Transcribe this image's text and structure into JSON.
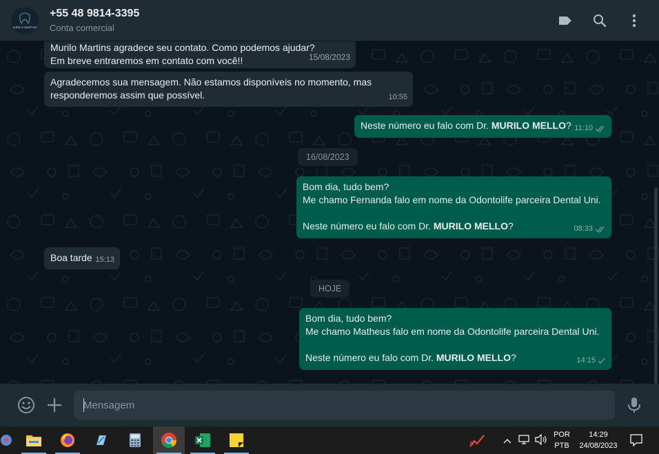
{
  "header": {
    "avatar_text": "MURILO MARTINS",
    "contact_name": "+55 48 9814-3395",
    "subtitle": "Conta comercial",
    "icons": [
      "label-icon",
      "search-icon",
      "menu-dots-icon"
    ]
  },
  "messages": [
    {
      "dir": "in",
      "lines": [
        "Murilo Martins agradece seu contato. Como podemos ajudar?",
        "Em breve entraremos em contato com você!!"
      ],
      "time": "15/08/2023"
    },
    {
      "dir": "in",
      "lines": [
        "Agradecemos sua mensagem. Não estamos disponíveis no momento, mas",
        "responderemos assim que possível."
      ],
      "time": "10:55"
    },
    {
      "dir": "out",
      "text_before": "Neste número eu falo com Dr. ",
      "bold": "MURILO MELLO",
      "text_after": "?",
      "time": "11:10",
      "status": "read"
    },
    {
      "dir": "out",
      "lines": [
        "Bom dia, tudo bem?",
        "Me chamo Fernanda falo em nome da Odontolife parceira Dental Uni."
      ],
      "text_before": "Neste número eu falo com Dr. ",
      "bold": "MURILO MELLO",
      "text_after": "?",
      "time": "08:33",
      "status": "read"
    },
    {
      "dir": "in",
      "lines": [
        "Boa tarde"
      ],
      "time": "15:13"
    },
    {
      "dir": "out",
      "lines": [
        "Bom dia, tudo bem?",
        "Me chamo Matheus falo em nome da Odontolife parceira Dental Uni."
      ],
      "text_before": "Neste número eu falo com Dr. ",
      "bold": "MURILO MELLO",
      "text_after": "?",
      "time": "14:15",
      "status": "sent"
    }
  ],
  "date_chips": [
    "16/08/2023",
    "HOJE"
  ],
  "composer": {
    "placeholder": "Mensagem",
    "icons": [
      "emoji-icon",
      "plus-icon",
      "microphone-icon"
    ]
  },
  "taskbar": {
    "apps": [
      "app-icon",
      "file-explorer-icon",
      "firefox-icon",
      "notepad-icon",
      "calculator-icon",
      "chrome-icon",
      "excel-icon",
      "sticky-notes-icon"
    ],
    "active_app": "chrome-icon",
    "tray": {
      "lang_top": "POR",
      "lang_bottom": "PTB",
      "time": "14:29",
      "date": "24/08/2023"
    }
  },
  "colors": {
    "incoming_bubble": "#202c33",
    "outgoing_bubble": "#005c4b",
    "read_tick": "#53bdeb",
    "background": "#0b141a"
  }
}
